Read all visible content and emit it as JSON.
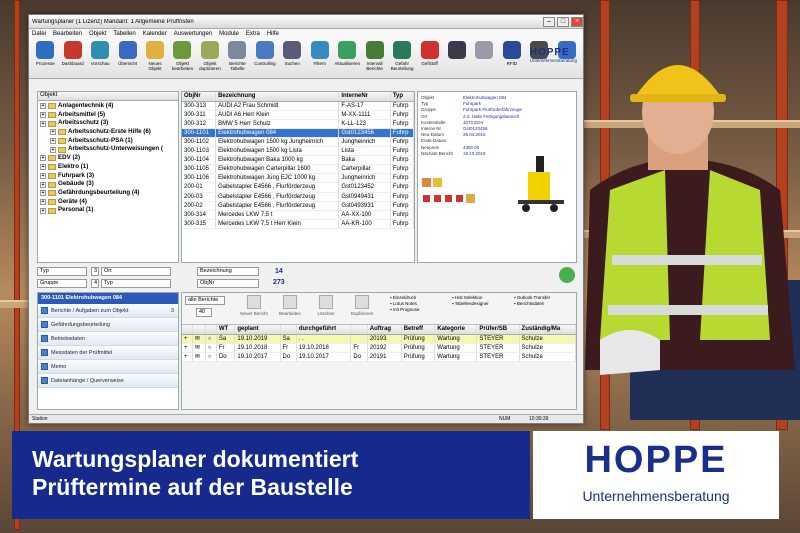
{
  "window": {
    "title": "Wartungsplaner (1 Lizenz)   Mandant: 1 Allgemeine Prüffristen",
    "menu": [
      "Datei",
      "Bearbeiten",
      "Objekt",
      "Tabellen",
      "Kalender",
      "Auswertungen",
      "Module",
      "Extra",
      "Hilfe"
    ]
  },
  "toolbar": {
    "buttons": [
      {
        "label": "Prozesse",
        "color": "#2f6ec2"
      },
      {
        "label": "Dashboard",
        "color": "#c23a2f"
      },
      {
        "label": "Vorschau",
        "color": "#2f8fb0"
      },
      {
        "label": "Übersicht",
        "color": "#3a6bc2"
      },
      {
        "label": "Neues Objekt",
        "color": "#e0b040"
      },
      {
        "label": "Objekt bearbeiten",
        "color": "#6a9a3a"
      },
      {
        "label": "Objekt duplizieren",
        "color": "#9aaa5a"
      },
      {
        "label": "Berichte Tabelle",
        "color": "#7a8a9a"
      },
      {
        "label": "Controlling",
        "color": "#4a7ac2"
      },
      {
        "label": "Suchen",
        "color": "#5a5a7a"
      },
      {
        "label": "Filtern",
        "color": "#3a8ac2"
      },
      {
        "label": "Aktualisieren",
        "color": "#3aa060"
      },
      {
        "label": "Intervall Berichte",
        "color": "#4a7a3a"
      },
      {
        "label": "Gefahr Beurteilung",
        "color": "#2a7a5a"
      },
      {
        "label": "GefStoff",
        "color": "#d03030"
      },
      {
        "label": "",
        "color": "#3a3a4a"
      },
      {
        "label": "",
        "color": "#9a9aaa"
      },
      {
        "label": "RFID",
        "color": "#2a4a9a"
      },
      {
        "label": "",
        "color": "#4a4a4a"
      },
      {
        "label": "",
        "color": "#3a6ac2"
      }
    ],
    "brand": "HOPPE",
    "brand_sub": "Unternehmensberatung"
  },
  "tree": {
    "header": "Objekt",
    "items": [
      {
        "label": "Anlagentechnik  (4)",
        "level": 0
      },
      {
        "label": "Arbeitsmittel  (5)",
        "level": 0
      },
      {
        "label": "Arbeitsschutz  (3)",
        "level": 0
      },
      {
        "label": "Arbeitsschutz-Erste Hilfe  (6)",
        "level": 1
      },
      {
        "label": "Arbeitsschutz-PSA  (1)",
        "level": 1
      },
      {
        "label": "Arbeitsschutz-Unterweisungen (",
        "level": 1
      },
      {
        "label": "EDV  (2)",
        "level": 0
      },
      {
        "label": "Elektro  (1)",
        "level": 0
      },
      {
        "label": "Fuhrpark  (3)",
        "level": 0
      },
      {
        "label": "Gebäude  (3)",
        "level": 0
      },
      {
        "label": "Gefährdungsbeurteilung  (4)",
        "level": 0
      },
      {
        "label": "Geräte  (4)",
        "level": 0
      },
      {
        "label": "Personal  (1)",
        "level": 0
      }
    ]
  },
  "grid": {
    "columns": [
      "ObjNr",
      "Bezeichnung",
      "InterneNr",
      "Typ"
    ],
    "rows": [
      [
        "300-313",
        "AUDI A2 Frau Schmidt",
        "F-AS-17",
        "Fuhrp"
      ],
      [
        "300-311",
        "AUDI A6 Herr Klein",
        "M-XX-1111",
        "Fuhrp"
      ],
      [
        "300-312",
        "BMW 5 Herr Schulz",
        "K-LL-123",
        "Fuhrp"
      ],
      [
        "300-1101",
        "Elektrohubwagen 084",
        "Gst0123456",
        "Fuhrp"
      ],
      [
        "300-1102",
        "Elektrohubwagen 1500 kg  Jungheinrich",
        "Jungheinrich",
        "Fuhrp"
      ],
      [
        "300-1103",
        "Elektrohubwagen 1500 kg Lista",
        "Lista",
        "Fuhrp"
      ],
      [
        "300-1104",
        "Elektrohubwagen Baka 1000 kg",
        "Baka",
        "Fuhrp"
      ],
      [
        "300-1105",
        "Elektrohubwagen Carterpillar 1600",
        "Carterpillar",
        "Fuhrp"
      ],
      [
        "300-1106",
        "Elektrohubwagen Jung EJC 1000 kg",
        "Jungheinrich",
        "Fuhrp"
      ],
      [
        "200-01",
        "Gabelstapler E4566 , Flurförderzeug",
        "Gst0123452",
        "Fuhrp"
      ],
      [
        "200-03",
        "Gabelstapler E4566 , Flurförderzeug",
        "Gst0949431",
        "Fuhrp"
      ],
      [
        "200-02",
        "Gabelstapler E4566 , Flurförderzeug",
        "Gst0493931",
        "Fuhrp"
      ],
      [
        "300-314",
        "Mercedes LKW 7,5 t",
        "AA-XX-100",
        "Fuhrp"
      ],
      [
        "300-315",
        "Mercedes LKW 7,5 t Herr Klein",
        "AA-KR-100",
        "Fuhrp"
      ]
    ],
    "selected_index": 3
  },
  "detail": {
    "fields": [
      {
        "k": "Objekt",
        "v": "Elektrohubwagen 084"
      },
      {
        "k": "Typ",
        "v": "Fuhrpark"
      },
      {
        "k": "Gruppe",
        "v": "Fuhrpark-Flurförderfahrzeuge"
      },
      {
        "k": "Ort",
        "v": "2.2. Halle Fertigungsbereich"
      },
      {
        "k": "Kostenstelle",
        "v": "1070 EDV"
      },
      {
        "k": "Interne Nr.",
        "v": "Gst0123456"
      },
      {
        "k": "Neu-Datum",
        "v": "26.04.2015"
      },
      {
        "k": "Ende-Datum",
        "v": ""
      },
      {
        "k": "Neupreis",
        "v": "4350,00"
      },
      {
        "k": "Nächste Bericht",
        "v": "19.10.2019"
      }
    ]
  },
  "filters": {
    "f1_label": "Typ",
    "f1_num": "3",
    "f1_field": "Ort",
    "f2_label": "Gruppe",
    "f2_num": "4",
    "f2_field": "Typ",
    "sort_field": "Bezeichnung",
    "sort_field2": "ObjNr",
    "count1": "14",
    "count2": "273"
  },
  "sidepanel": {
    "title": "300-1101 Elektrohubwagen 084",
    "items": [
      {
        "label": "Berichte / Aufgaben zum Objekt",
        "count": "3"
      },
      {
        "label": "Gefährdungsbeurteilung",
        "count": ""
      },
      {
        "label": "Betriebsdaten",
        "count": ""
      },
      {
        "label": "Messdaten der Prüfmittel",
        "count": ""
      },
      {
        "label": "Memo",
        "count": ""
      },
      {
        "label": "Dateianhänge / Querverweise",
        "count": ""
      }
    ]
  },
  "reports_toolbar": {
    "select": "alle Berichte",
    "num": "40",
    "buttons": [
      "Neuer Bericht",
      "Bearbeiten",
      "Löschen",
      "Duplizieren"
    ],
    "links": [
      "Einzeldruck",
      "Hist Selektion",
      "Outlook Transfer",
      "Lotus Notes",
      "Tabellendesigner",
      "Berichtsdaten",
      "mit Prognose"
    ]
  },
  "reports": {
    "columns": [
      "",
      "",
      "",
      "WT",
      "geplant",
      "",
      "durchgeführt",
      "",
      "Auftrag",
      "Betreff",
      "Kategorie",
      "Prüfer/SB",
      "Zuständig/Ma"
    ],
    "rows": [
      [
        "Sa",
        "19.10.2019",
        "Sa",
        ". .",
        "",
        "20193",
        "Prüfung",
        "Wartung",
        "STEYER",
        "Schulze"
      ],
      [
        "Fr",
        "19.10.2018",
        "Fr",
        "19.10.2018",
        "Fr",
        "20192",
        "Prüfung",
        "Wartung",
        "STEYER",
        "Schulze"
      ],
      [
        "Do",
        "19.10.2017",
        "Do",
        "19.10.2017",
        "Do",
        "20191",
        "Prüfung",
        "Wartung",
        "STEYER",
        "Schulze"
      ]
    ]
  },
  "status": {
    "left": "Station",
    "mid": "NUM",
    "time": "10:30:39"
  },
  "banner": {
    "line1": "Wartungsplaner dokumentiert",
    "line2": "Prüftermine auf der Baustelle",
    "logo": "HOPPE",
    "logo_sub": "Unternehmensberatung"
  }
}
